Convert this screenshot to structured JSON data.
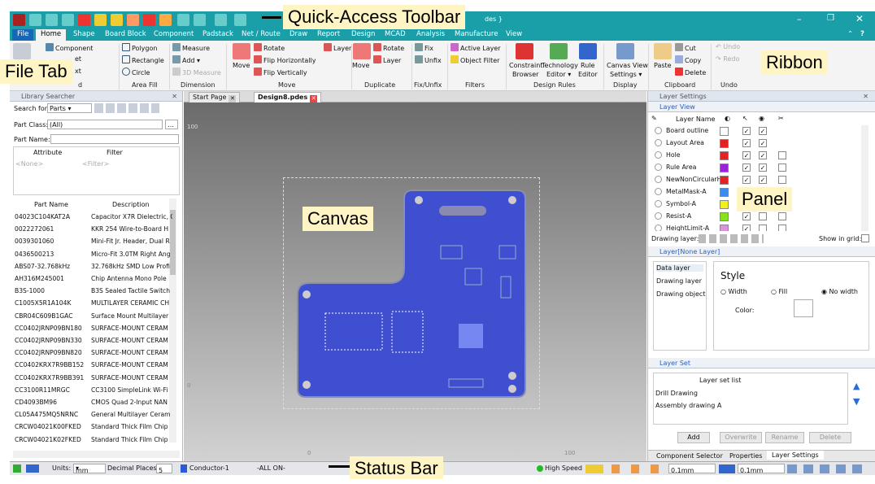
{
  "callouts": {
    "qat": "Quick-Access Toolbar",
    "ribbon": "Ribbon",
    "filetab": "File Tab",
    "canvas": "Canvas",
    "panel": "Panel",
    "status": "Status Bar"
  },
  "title": {
    "text": "des }"
  },
  "menu": {
    "file": "File",
    "tabs": [
      "Home",
      "Shape",
      "Board Block",
      "Component",
      "Padstack",
      "Net / Route",
      "Draw",
      "Report",
      "Design",
      "MCAD",
      "Analysis",
      "Manufacture",
      "View"
    ]
  },
  "ribbon": {
    "add": {
      "component": "Component",
      "net": "et",
      "text": "xt",
      "group": "d"
    },
    "areafill": {
      "polygon": "Polygon",
      "rectangle": "Rectangle",
      "circle": "Circle",
      "group": "Area Fill"
    },
    "dimension": {
      "measure": "Measure",
      "add": "Add",
      "measure3d": "3D Measure",
      "group": "Dimension"
    },
    "move": {
      "move": "Move",
      "rotate": "Rotate",
      "fliph": "Flip Horizontally",
      "flipv": "Flip Vertically",
      "layer": "Layer",
      "group": "Move"
    },
    "duplicate": {
      "move": "Move",
      "rotate": "Rotate",
      "layer": "Layer",
      "group": "Duplicate"
    },
    "fix": {
      "fix": "Fix",
      "unfix": "Unfix",
      "group": "Fix/Unfix"
    },
    "filters": {
      "active": "Active Layer",
      "object": "Object Filter",
      "group": "Filters"
    },
    "rules": {
      "browser1": "Constraint",
      "browser2": "Browser",
      "tech1": "Technology",
      "tech2": "Editor",
      "rule1": "Rule",
      "rule2": "Editor",
      "group": "Design Rules"
    },
    "display": {
      "cv1": "Canvas View",
      "cv2": "Settings",
      "group": "Display"
    },
    "clipboard": {
      "paste": "Paste",
      "cut": "Cut",
      "copy": "Copy",
      "delete": "Delete",
      "group": "Clipboard"
    },
    "undo": {
      "undo": "Undo",
      "redo": "Redo",
      "group": "Undo"
    }
  },
  "library": {
    "title": "Library Searcher",
    "search_for_label": "Search for:",
    "search_for": "Parts",
    "part_class_label": "Part Class:",
    "part_class": "(All)",
    "part_name_label": "Part Name:",
    "attr_header": "Attribute",
    "filter_header": "Filter",
    "attr_none": "<None>",
    "filter_none": "<Filter>",
    "col_part": "Part Name",
    "col_desc": "Description",
    "rows": [
      [
        "04023C104KAT2A",
        "Capacitor X7R Dielectric, C"
      ],
      [
        "0022272061",
        "KKR 254 Wire-to-Board H"
      ],
      [
        "0039301060",
        "Mini-Fit Jr. Header, Dual R"
      ],
      [
        "0436500213",
        "Micro-Fit 3.0TM Right Ang"
      ],
      [
        "ABS07-32.768kHz",
        "32.768kHz SMD Low Profi"
      ],
      [
        "AH316M245001",
        "Chip Antenna Mono Pole"
      ],
      [
        "B3S-1000",
        "B3S Sealed Tactile Switch"
      ],
      [
        "C1005X5R1A104K",
        "MULTILAYER CERAMIC CH"
      ],
      [
        "CBR04C609B1GAC",
        "Surface Mount Multilayer"
      ],
      [
        "CC0402JRNP09BN180",
        "SURFACE-MOUNT CERAM"
      ],
      [
        "CC0402JRNP09BN330",
        "SURFACE-MOUNT CERAM"
      ],
      [
        "CC0402JRNP09BN820",
        "SURFACE-MOUNT CERAM"
      ],
      [
        "CC0402KRX7R9BB152",
        "SURFACE-MOUNT CERAM"
      ],
      [
        "CC0402KRX7R9BB391",
        "SURFACE-MOUNT CERAM"
      ],
      [
        "CC3100R11MRGC",
        "CC3100 SimpleLink Wi-Fi"
      ],
      [
        "CD4093BM96",
        "CMOS Quad 2-Input NAN"
      ],
      [
        "CL05A475MQ5NRNC",
        "General Multilayer Ceram"
      ],
      [
        "CRCW04021K00FKED",
        "Standard Thick Film Chip"
      ],
      [
        "CRCW04021K02FKED",
        "Standard Thick Film Chip"
      ]
    ]
  },
  "doc": {
    "tab1": "Start Page",
    "tab2": "Design8.pdes",
    "ruler_top": "100",
    "ruler_left": "0",
    "ruler_b0": "0",
    "ruler_b100": "100"
  },
  "layers": {
    "title": "Layer Settings",
    "view_title": "Layer View",
    "col_name": "Layer Name",
    "rows": [
      {
        "name": "Board outline",
        "color": "#ffffff"
      },
      {
        "name": "Layout Area",
        "color": "#e52222"
      },
      {
        "name": "Hole",
        "color": "#e52222"
      },
      {
        "name": "Rule Area",
        "color": "#9b22d8"
      },
      {
        "name": "NewNonCircularHo",
        "color": "#e52222"
      },
      {
        "name": "MetalMask-A",
        "color": "#3c8cf0"
      },
      {
        "name": "Symbol-A",
        "color": "#f0f020"
      },
      {
        "name": "Resist-A",
        "color": "#88e020"
      },
      {
        "name": "HeightLimit-A",
        "color": "#e090e0"
      }
    ],
    "drawing_layer": "Drawing layer:",
    "show_grid": "Show in grid:",
    "layer_title": "Layer[None Layer]",
    "list": [
      "Data layer",
      "Drawing layer",
      "Drawing object"
    ],
    "style": "Style",
    "width": "Width",
    "fill": "Fill",
    "nowidth": "No width",
    "color": "Color:",
    "set_title": "Layer Set",
    "set_header": "Layer set list",
    "sets": [
      "Drill Drawing",
      "Assembly drawing A"
    ],
    "btn_add": "Add",
    "btn_overwrite": "Overwrite",
    "btn_rename": "Rename",
    "btn_delete": "Delete",
    "tabs": [
      "Component Selector",
      "Properties",
      "Layer Settings"
    ]
  },
  "status": {
    "units_label": "Units:",
    "units": "mm",
    "dec_label": "Decimal Places:",
    "dec": "5",
    "conductor": "Conductor-1",
    "allon": "-ALL ON-",
    "speed": "High Speed",
    "grid1": "0.1mm",
    "grid2": "0.1mm"
  },
  "colors": {
    "teal": "#1a9fa8",
    "board": "#3f4fcf",
    "callout": "#fff4c4"
  }
}
